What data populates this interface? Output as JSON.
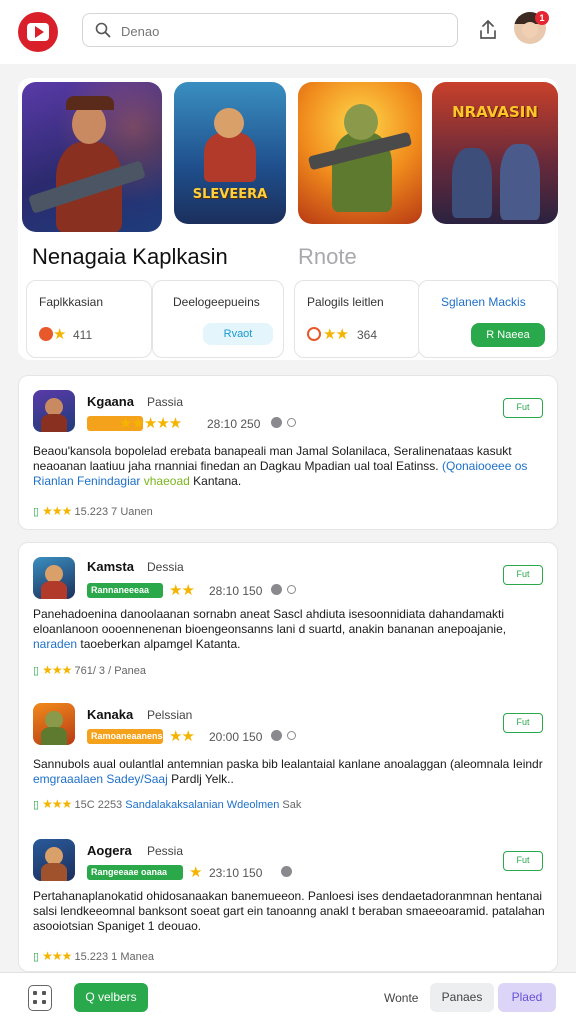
{
  "header": {
    "search_placeholder": "Denao",
    "notification_count": "1",
    "icons": [
      "logo-play-icon",
      "search-icon",
      "share-icon",
      "avatar"
    ]
  },
  "featured": {
    "art": [
      {
        "name": "soldier-art"
      },
      {
        "name": "sleveera-art",
        "title": "SLEVEERA"
      },
      {
        "name": "mech-art"
      },
      {
        "name": "nravasin-art",
        "title": "NRAVASIN"
      }
    ],
    "title": "Nenagaia Kaplkasin",
    "subtitle": "Rnote",
    "stats": [
      {
        "label": "Faplkkasian",
        "value": "411"
      },
      {
        "label": "Deelogeepueins",
        "button": "Rvaot"
      },
      {
        "label": "Palogils leitlen",
        "value": "364"
      },
      {
        "label": "Sglanen Mackis",
        "button": "R Naeea"
      }
    ]
  },
  "reviews": [
    {
      "name": "Kgaana",
      "publisher": "Passia",
      "meta": "28:10 250",
      "button": "Fut",
      "body": "Beaou'kansola bopolelad erebata banapeali man Jamal Solanilaca, Seralinenataas kasukt neaoanan laatiuu jaha rnanniai finedan an Dagkau Mpadian ual toal Eatinss.",
      "link": "(Qonaiooeee os Rianlan Fenindagiar",
      "highlight": "vhaeoad",
      "body_end": "Kantana.",
      "footer": "15.223 7 Uanen"
    },
    {
      "name": "Kamsta",
      "publisher": "Dessia",
      "tag": "Rannaneeeaa",
      "meta": "28:10 150",
      "button": "Fut",
      "body": "Panehadoenina danoolaanan sornabn aneat Sascl ahdiuta isesoonnidiata dahandamakti eloanlanoon oooennenenan bioengeonsanns lani d suartd, anakin bananan anepoajanie,",
      "link": "naraden",
      "body_end": "taoeberkan alpamgel Katanta.",
      "footer": "761/ 3 / Panea"
    },
    {
      "name": "Kanaka",
      "publisher": "Pelssian",
      "tag": "Ramoaneaanens",
      "meta": "20:00 150",
      "button": "Fut",
      "body": "Sannubols aual oulantlal antemnian paska bib lealantaial kanlane anoalaggan (aleomnala Ieindr",
      "link": "emgraaalaen Sadey/Saaj",
      "body_end": "Pardlj Yelk..",
      "footer_num": "15C 2253",
      "footer_link": "Sandalakaksalanian Wdeolmen",
      "footer_end": "Sak"
    },
    {
      "name": "Aogera",
      "publisher": "Pessia",
      "tag": "Rangeeaae oanaa",
      "meta": "23:10 150",
      "button": "Fut",
      "body": "Pertahanaplanokatid ohidosanaakan banemueeon. Panloesi ises dendaetadoranmnan hentanai salsi lendkeeomnal banksont soeat gart ein tanoanng anakl t beraban smaeeoaramid.",
      "body_end": "patalahan asooiotsian Spaniget 1 deouao.",
      "footer": "15.223 1 Manea"
    }
  ],
  "bottom_bar": {
    "cta": "Q velbers",
    "text": "Wonte",
    "btn_1": "Panaes",
    "btn_2": "Plaed"
  },
  "colors": {
    "brand_red": "#d9202a",
    "green": "#29a94b",
    "star": "#f5b400",
    "link_blue": "#1e70c9",
    "highlight_green": "#7ab51d",
    "tag_orange": "#f4a21c",
    "tag_green": "#2aa84a",
    "selected_purple": "#dcd5f7"
  }
}
